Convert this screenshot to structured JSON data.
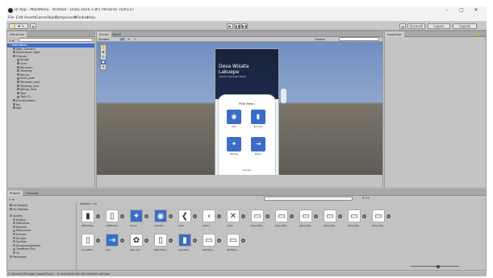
{
  "window": {
    "title": "UI App - MainMenu - Android - Unity 2020.3.8f1 Personal <DX11>",
    "minimize": "–",
    "maximize": "▢",
    "close": "✕"
  },
  "menu": [
    "File",
    "Edit",
    "Assets",
    "GameObject",
    "Component",
    "Window",
    "Help"
  ],
  "toolbar": {
    "account": "Account",
    "layers": "Layers",
    "layout": "Layout"
  },
  "hierarchy": {
    "tab": "Hierarchy",
    "add": "+ ▾",
    "items": [
      {
        "label": "MainMenu",
        "depth": 0
      },
      {
        "label": "Main Camera",
        "depth": 1
      },
      {
        "label": "Directional Light",
        "depth": 1
      },
      {
        "label": "Canvas",
        "depth": 1
      },
      {
        "label": "Image",
        "depth": 2
      },
      {
        "label": "Scan",
        "depth": 2
      },
      {
        "label": "Panduan",
        "depth": 2
      },
      {
        "label": "Tentang",
        "depth": 2
      },
      {
        "label": "Keluar",
        "depth": 2
      },
      {
        "label": "Scan_text",
        "depth": 2
      },
      {
        "label": "Panduan_text",
        "depth": 2
      },
      {
        "label": "Tentang_text",
        "depth": 2
      },
      {
        "label": "Keluar_text",
        "depth": 2
      },
      {
        "label": "Text",
        "depth": 2
      },
      {
        "label": "Text (1)",
        "depth": 2
      },
      {
        "label": "EventSystem",
        "depth": 1
      },
      {
        "label": "bg",
        "depth": 1
      },
      {
        "label": "bg1",
        "depth": 1
      }
    ],
    "selected_index": 0
  },
  "scene": {
    "tabs": [
      "Scene",
      "Game"
    ],
    "shading": "Shaded",
    "mode2d": "2D",
    "gizmos": "Gizmos",
    "all": "All",
    "phone_title_1": "Desa Wisata",
    "phone_title_2": "Lakuepe",
    "phone_subtitle": "Aplikasi Augmented Reality",
    "menu_heading": "Pilih Menu",
    "menu_items": [
      {
        "label": "Scan",
        "icon": "camera-icon",
        "glyph": "◉"
      },
      {
        "label": "Panduan",
        "icon": "book-icon",
        "glyph": "▮"
      },
      {
        "label": "Tentang",
        "icon": "info-icon",
        "glyph": "✦"
      },
      {
        "label": "Keluar",
        "icon": "exit-icon",
        "glyph": "⇥"
      }
    ],
    "bottom_label": "Lakuepe"
  },
  "inspector": {
    "tab": "Inspector"
  },
  "project": {
    "tabs": [
      "Project",
      "Console"
    ],
    "add": "+ ▾",
    "favorites": [
      "All Models",
      "All Prefabs"
    ],
    "breadcrumb": "Assets > UI",
    "tree": [
      {
        "label": "Assets",
        "depth": 0
      },
      {
        "label": "Button",
        "depth": 1
      },
      {
        "label": "Materials",
        "depth": 1
      },
      {
        "label": "Models",
        "depth": 1
      },
      {
        "label": "Resources",
        "depth": 1
      },
      {
        "label": "Scenes",
        "depth": 1
      },
      {
        "label": "Scripts",
        "depth": 1
      },
      {
        "label": "Sprites",
        "depth": 1
      },
      {
        "label": "StreamingAssets",
        "depth": 1
      },
      {
        "label": "TextMesh Pro",
        "depth": 1
      },
      {
        "label": "UI",
        "depth": 1
      },
      {
        "label": "Packages",
        "depth": 0
      }
    ],
    "assets_row1": [
      "09fd74ab...",
      "29f55a3a...",
      "about",
      "camera",
      "back",
      "back1",
      "close",
      "Desa Wis...",
      "Desa Wis...",
      "Desa Wis...",
      "Desa Wis...",
      "Desa Wis...",
      "Desa Wis..."
    ],
    "assets_row2": [
      "hlu_6f50...",
      "exit",
      "logo ug...",
      "MainMenu",
      "panduan",
      "Tentang...",
      "Tentang..."
    ],
    "hidden_count": "⊘ 15"
  },
  "status": {
    "text": "⚠ Assets/UI/image_target/Scan... is imported with the default settings"
  },
  "colors": {
    "accent": "#3b6cc8",
    "selection": "#3d6dcc",
    "sky_top": "#6f8ec1",
    "ground": "#5f5b56"
  }
}
